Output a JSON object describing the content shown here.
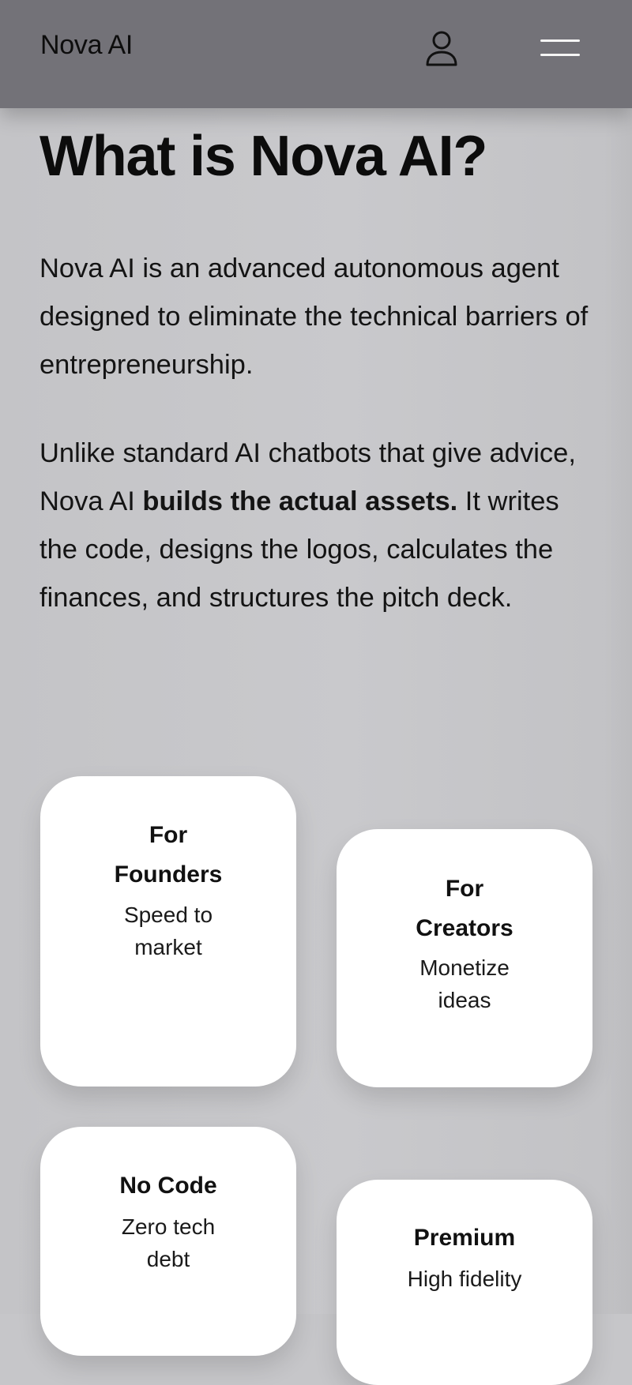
{
  "header": {
    "brand": "Nova AI",
    "icons": {
      "account": "user-icon",
      "menu": "hamburger-menu-icon"
    },
    "background_color": "#737278"
  },
  "main": {
    "title": "What is Nova AI?",
    "paragraph1": "Nova AI is an advanced autonomous agent designed to eliminate the technical barriers of entrepreneurship.",
    "paragraph2": {
      "before": "Unlike standard AI chatbots that give advice, Nova AI ",
      "bold": "builds the actual assets.",
      "after": " It writes the code, designs the logos, calculates the finances, and structures the pitch deck."
    }
  },
  "cards": [
    {
      "heading": [
        "For",
        "Founders"
      ],
      "subtitle": [
        "Speed to",
        "market"
      ]
    },
    {
      "heading": [
        "For",
        "Creators"
      ],
      "subtitle": [
        "Monetize",
        "ideas"
      ]
    },
    {
      "heading": [
        "No Code"
      ],
      "subtitle": [
        "Zero tech",
        "debt"
      ]
    },
    {
      "heading": [
        "Premium"
      ],
      "subtitle": [
        "High fidelity"
      ]
    }
  ],
  "colors": {
    "page_background": "#c6c6c9",
    "card_background": "#ffffff",
    "text": "#111111"
  }
}
